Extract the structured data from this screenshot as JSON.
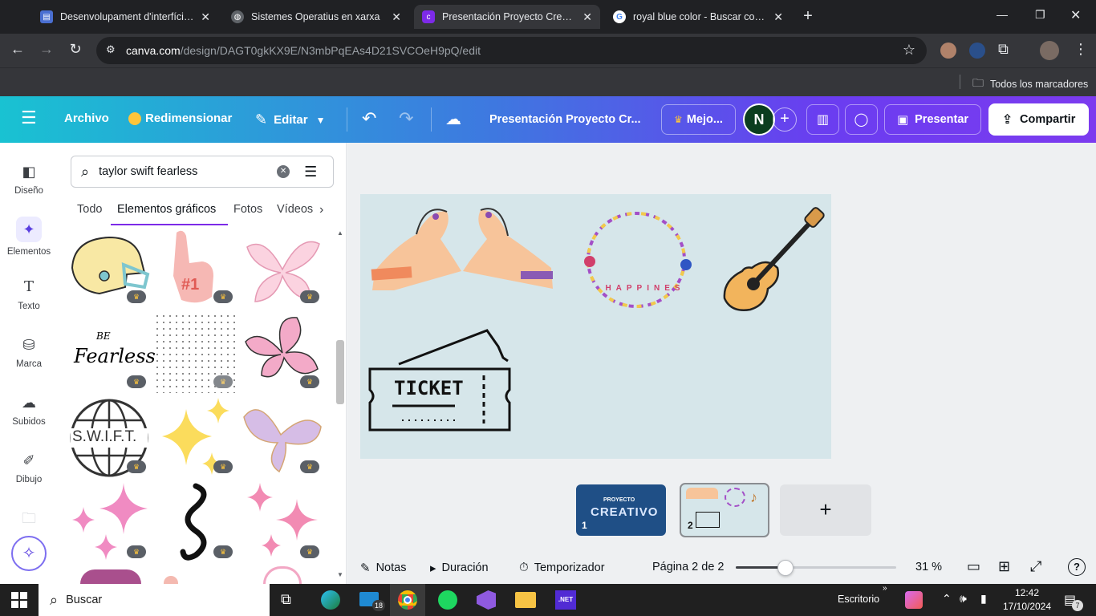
{
  "browser": {
    "tabs": [
      {
        "title": "Desenvolupament d'interfícies·"
      },
      {
        "title": "Sistemes Operatius en xarxa"
      },
      {
        "title": "Presentación Proyecto Creativo"
      },
      {
        "title": "royal blue color - Buscar con Go"
      }
    ],
    "url_host": "canva.com",
    "url_path": "/design/DAGT0gkKX9E/N3mbPqEAs4D21SVCOeH9pQ/edit",
    "bookmarks_label": "Todos los marcadores"
  },
  "header": {
    "file": "Archivo",
    "resize": "Redimensionar",
    "edit": "Editar",
    "design_title": "Presentación Proyecto Cr...",
    "upgrade": "Mejo...",
    "avatar_letter": "N",
    "present": "Presentar",
    "share": "Compartir"
  },
  "sidebar": {
    "items": [
      {
        "label": "Diseño"
      },
      {
        "label": "Elementos"
      },
      {
        "label": "Texto"
      },
      {
        "label": "Marca"
      },
      {
        "label": "Subidos"
      },
      {
        "label": "Dibujo"
      }
    ]
  },
  "panel": {
    "search_value": "taylor swift fearless",
    "tabs": [
      "Todo",
      "Elementos gráficos",
      "Fotos",
      "Vídeos"
    ],
    "grid_texts": {
      "be": "BE",
      "fearless": "Fearless",
      "swift": "S.W.I.F.T.",
      "number": "#1"
    }
  },
  "canvas": {
    "bracelet_text": "HAPPINES",
    "ticket_text": "TICKET"
  },
  "pages": {
    "thumb1_label": "PROYECTO",
    "thumb1_title": "CREATIVO",
    "thumb1_num": "1",
    "thumb2_num": "2",
    "add_page": "+"
  },
  "footer": {
    "notes": "Notas",
    "duration": "Duración",
    "timer": "Temporizador",
    "page_info": "Página 2 de 2",
    "zoom": "31 %",
    "zoom_value": 0.31
  },
  "taskbar": {
    "search": "Buscar",
    "mail_badge": "18",
    "dotnet": ".NET",
    "desktop": "Escritorio",
    "time": "12:42",
    "date": "17/10/2024",
    "notif_count": "7"
  },
  "colors": {
    "accent": "#7d2ae8",
    "header_start": "#19c2d2",
    "header_end": "#7c3bef"
  }
}
